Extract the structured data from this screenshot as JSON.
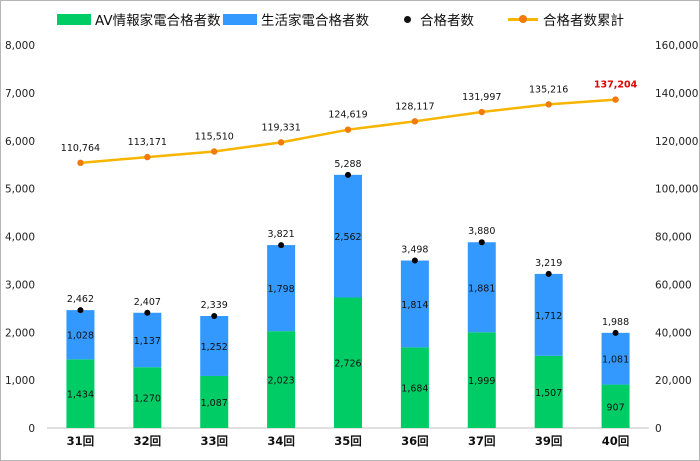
{
  "chart_data": {
    "type": "bar",
    "categories": [
      "31回",
      "32回",
      "33回",
      "34回",
      "35回",
      "36回",
      "37回",
      "39回",
      "40回"
    ],
    "series": [
      {
        "name": "AV情報家電合格者数",
        "type": "stacked-bar",
        "axis": "left",
        "color": "#00cc66",
        "values": [
          1434,
          1270,
          1087,
          2023,
          2726,
          1684,
          1999,
          1507,
          907
        ],
        "labels": [
          "1,434",
          "1,270",
          "1,087",
          "2,023",
          "2,726",
          "1,684",
          "1,999",
          "1,507",
          "907"
        ]
      },
      {
        "name": "生活家電合格者数",
        "type": "stacked-bar",
        "axis": "left",
        "color": "#3399ff",
        "values": [
          1028,
          1137,
          1252,
          1798,
          2562,
          1814,
          1881,
          1712,
          1081
        ],
        "labels": [
          "1,028",
          "1,137",
          "1,252",
          "1,798",
          "2,562",
          "1,814",
          "1,881",
          "1,712",
          "1,081"
        ]
      },
      {
        "name": "合格者数",
        "type": "dot",
        "axis": "left",
        "color": "#000000",
        "values": [
          2462,
          2407,
          2339,
          3821,
          5288,
          3498,
          3880,
          3219,
          1988
        ],
        "labels": [
          "2,462",
          "2,407",
          "2,339",
          "3,821",
          "5,288",
          "3,498",
          "3,880",
          "3,219",
          "1,988"
        ]
      },
      {
        "name": "合格者数累計",
        "type": "line",
        "axis": "right",
        "color": "#f7b500",
        "marker_color": "#f07a0a",
        "values": [
          110764,
          113171,
          115510,
          119331,
          124619,
          128117,
          131997,
          135216,
          137204
        ],
        "labels": [
          "110,764",
          "113,171",
          "115,510",
          "119,331",
          "124,619",
          "128,117",
          "131,997",
          "135,216",
          "137,204"
        ],
        "highlight_last_color": "#e00000"
      }
    ],
    "left_axis": {
      "ylim": [
        0,
        8000
      ],
      "ticks": [
        "0",
        "1,000",
        "2,000",
        "3,000",
        "4,000",
        "5,000",
        "6,000",
        "7,000",
        "8,000"
      ]
    },
    "right_axis": {
      "ylim": [
        0,
        160000
      ],
      "ticks": [
        "0",
        "20,000",
        "40,000",
        "60,000",
        "80,000",
        "100,000",
        "120,000",
        "140,000",
        "160,000"
      ]
    },
    "grid": false,
    "legend_position": "top"
  }
}
